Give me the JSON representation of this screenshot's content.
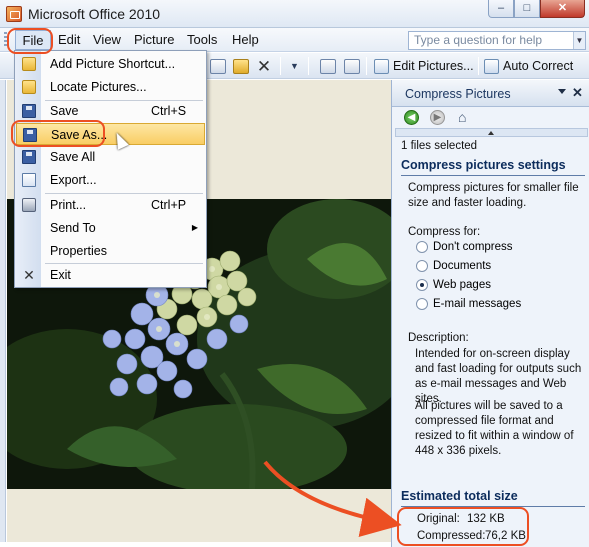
{
  "window": {
    "title": "Microsoft Office 2010"
  },
  "menubar": {
    "items": [
      "File",
      "Edit",
      "View",
      "Picture",
      "Tools",
      "Help"
    ],
    "ask_placeholder": "Type a question for help"
  },
  "toolbar": {
    "edit_pictures": "Edit Pictures...",
    "auto_correct": "Auto Correct"
  },
  "file_menu": {
    "items": [
      {
        "label": "Add Picture Shortcut...",
        "shortcut": "",
        "icon": "add-shortcut-icon"
      },
      {
        "label": "Locate Pictures...",
        "shortcut": "",
        "icon": "locate-pictures-icon"
      },
      {
        "label": "Save",
        "shortcut": "Ctrl+S",
        "icon": "save-icon"
      },
      {
        "label": "Save As...",
        "shortcut": "",
        "icon": "save-as-icon"
      },
      {
        "label": "Save All",
        "shortcut": "",
        "icon": "save-all-icon"
      },
      {
        "label": "Export...",
        "shortcut": "",
        "icon": "export-icon"
      },
      {
        "label": "Print...",
        "shortcut": "Ctrl+P",
        "icon": "print-icon"
      },
      {
        "label": "Send To",
        "shortcut": "",
        "icon": "send-to-icon"
      },
      {
        "label": "Properties",
        "shortcut": "",
        "icon": "properties-icon"
      },
      {
        "label": "Exit",
        "shortcut": "",
        "icon": "exit-icon"
      }
    ],
    "selected": "Save As..."
  },
  "pane": {
    "title": "Compress Pictures",
    "files_selected": "1 files selected",
    "settings_heading": "Compress pictures settings",
    "intro": "Compress pictures for smaller file size and faster loading.",
    "compress_for_label": "Compress for:",
    "options": [
      "Don't compress",
      "Documents",
      "Web pages",
      "E-mail messages"
    ],
    "selected_option": "Web pages",
    "description_label": "Description:",
    "description": "Intended for on-screen display and fast loading for outputs such as e-mail messages and Web sites.",
    "note": "All pictures will be saved to a compressed file format and resized to fit within a window of 448 x 336 pixels.",
    "estimated_heading": "Estimated total size",
    "original_label": "Original:",
    "original_value": "132 KB",
    "compressed_label": "Compressed:",
    "compressed_value": "76,2 KB"
  },
  "colors": {
    "highlight": "#ec4f23",
    "menu_selected": "#f9cd64",
    "pane_bg": "#eef3fa"
  }
}
